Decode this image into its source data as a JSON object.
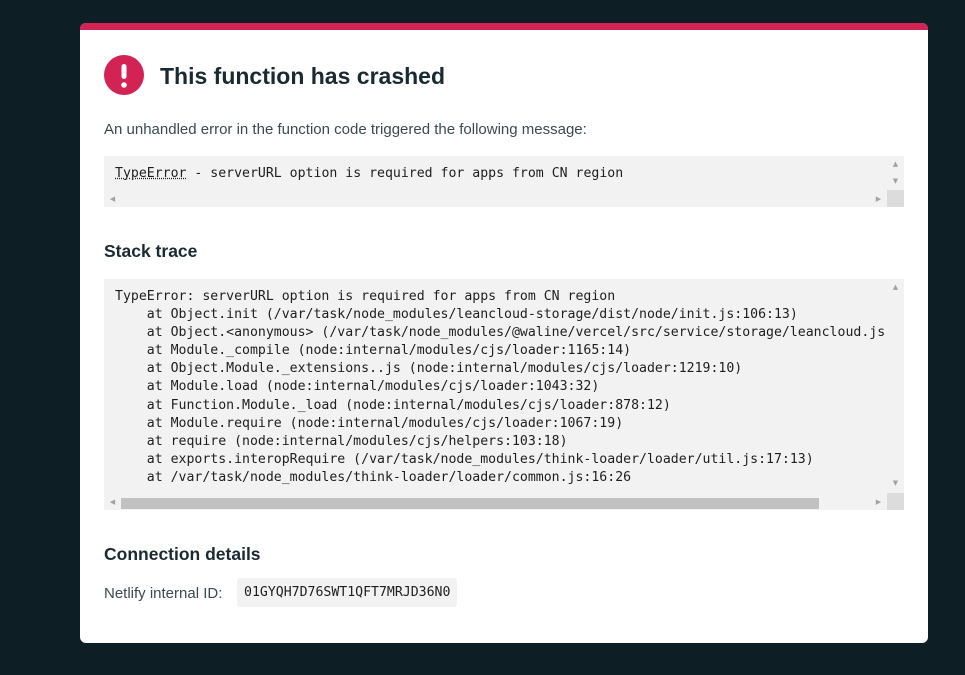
{
  "error": {
    "title": "This function has crashed",
    "intro": "An unhandled error in the function code triggered the following message:",
    "message_type": "TypeError",
    "message_rest": " - serverURL option is required for apps from CN region"
  },
  "stack_trace": {
    "heading": "Stack trace",
    "lines": [
      "TypeError: serverURL option is required for apps from CN region",
      "    at Object.init (/var/task/node_modules/leancloud-storage/dist/node/init.js:106:13)",
      "    at Object.<anonymous> (/var/task/node_modules/@waline/vercel/src/service/storage/leancloud.js",
      "    at Module._compile (node:internal/modules/cjs/loader:1165:14)",
      "    at Object.Module._extensions..js (node:internal/modules/cjs/loader:1219:10)",
      "    at Module.load (node:internal/modules/cjs/loader:1043:32)",
      "    at Function.Module._load (node:internal/modules/cjs/loader:878:12)",
      "    at Module.require (node:internal/modules/cjs/loader:1067:19)",
      "    at require (node:internal/modules/cjs/helpers:103:18)",
      "    at exports.interopRequire (/var/task/node_modules/think-loader/loader/util.js:17:13)",
      "    at /var/task/node_modules/think-loader/loader/common.js:16:26"
    ]
  },
  "connection": {
    "heading": "Connection details",
    "label": "Netlify internal ID:",
    "id": "01GYQH7D76SWT1QFT7MRJD36N0"
  },
  "icons": {
    "alert": "alert-circle-icon"
  },
  "colors": {
    "accent": "#d32254",
    "page_background": "#0e1e25",
    "code_background": "#f2f2f2"
  }
}
